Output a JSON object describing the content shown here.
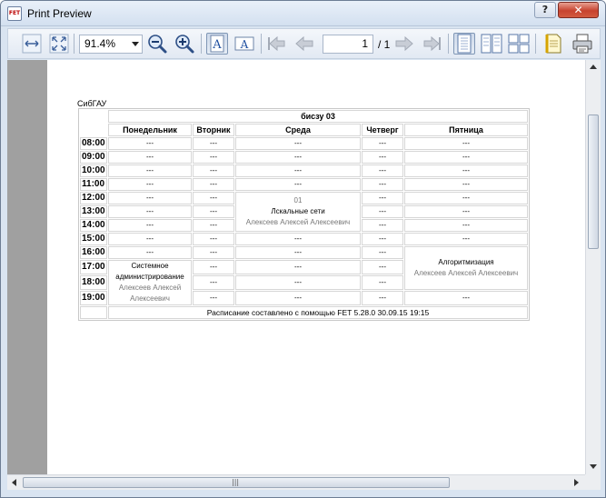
{
  "window": {
    "title": "Print Preview",
    "app_icon_text": "FET",
    "help_label": "?",
    "close_label": "✕"
  },
  "toolbar": {
    "zoom_value": "91.4%",
    "page_current": "1",
    "page_total": "/ 1"
  },
  "timetable": {
    "institution": "СибГАУ",
    "group": "бисзу 03",
    "days": [
      "Понедельник",
      "Вторник",
      "Среда",
      "Четверг",
      "Пятница"
    ],
    "times": [
      "08:00",
      "09:00",
      "10:00",
      "11:00",
      "12:00",
      "13:00",
      "14:00",
      "15:00",
      "16:00",
      "17:00",
      "18:00",
      "19:00"
    ],
    "empty": "---",
    "course_room": "01",
    "course_name": "Лскальные сети",
    "course_teacher": "Алексеев Алексей Алексеевич",
    "course2_name": "Системное администрирование",
    "course2_teacher": "Алексеев Алексей Алексеевич",
    "course3_name": "Алгоритмизация",
    "course3_teacher": "Алексеев Алексей Алексеевич",
    "credits": "Расписание составлено с помощью FET 5.28.0 30.09.15 19:15"
  },
  "scroll": {
    "h_thumb_label": "|||"
  }
}
